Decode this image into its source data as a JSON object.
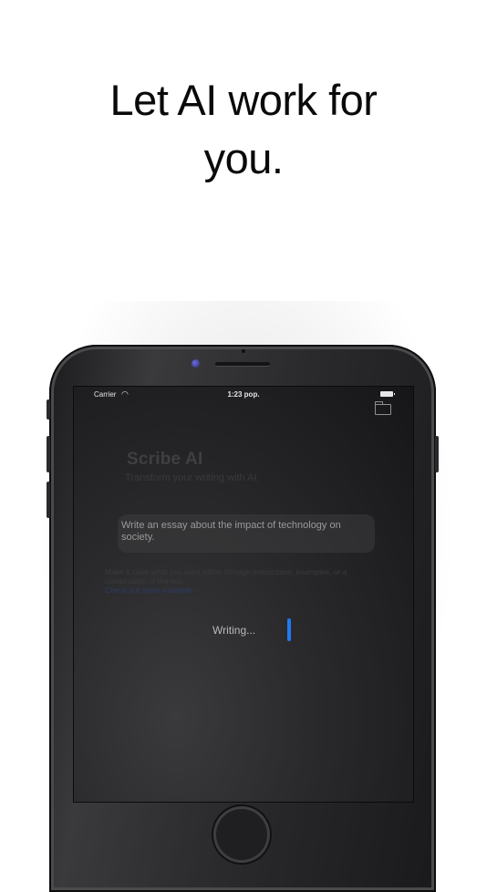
{
  "headline": {
    "line1": "Let AI work for",
    "line2": "you."
  },
  "status_bar": {
    "carrier": "Carrier",
    "wifi_icon": "wifi-icon",
    "time": "1:23 pop.",
    "battery_icon": "battery-icon"
  },
  "toolbar": {
    "folder_icon": "folder-icon"
  },
  "app": {
    "title": "Scribe AI",
    "subtitle": "Transform your writing with AI.",
    "prompt": "Write an essay about the impact of technology on society.",
    "hint": "Make it clear what you want either through instructions, examples, or a combination of the two.",
    "hint_link": "Check out some example",
    "writing_label": "Writing..."
  },
  "colors": {
    "accent": "#1E7BF0",
    "screen": "#1C1C1E",
    "frame": "#2A2A2C"
  }
}
